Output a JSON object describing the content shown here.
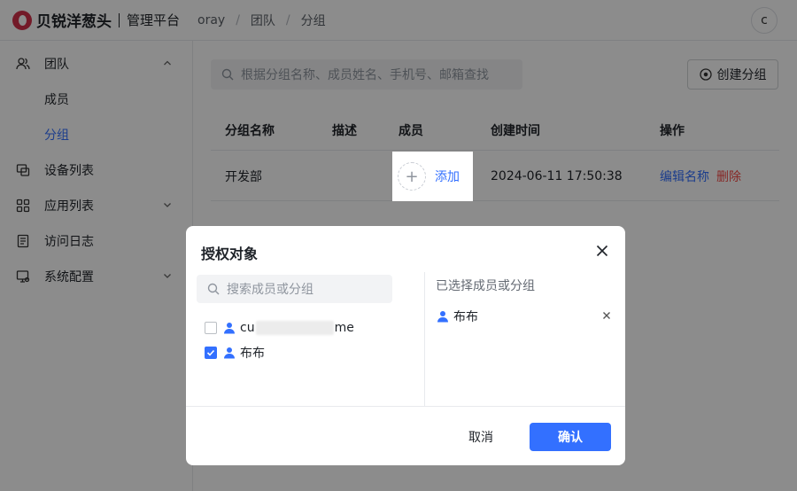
{
  "header": {
    "logo_text": "贝锐洋葱头",
    "platform": "管理平台",
    "breadcrumb": [
      "oray",
      "团队",
      "分组"
    ],
    "breadcrumb_sep": "/",
    "avatar_initial": "c"
  },
  "sidebar": {
    "team": "团队",
    "sub_members": "成员",
    "sub_groups": "分组",
    "devices": "设备列表",
    "apps": "应用列表",
    "logs": "访问日志",
    "settings": "系统配置"
  },
  "main": {
    "search_placeholder": "根据分组名称、成员姓名、手机号、邮箱查找",
    "create_button": "创建分组",
    "columns": [
      "分组名称",
      "描述",
      "成员",
      "创建时间",
      "操作"
    ],
    "rows": [
      {
        "name": "开发部",
        "description": "",
        "add_label": "添加",
        "created": "2024-06-11 17:50:38",
        "edit": "编辑名称",
        "delete": "删除"
      }
    ]
  },
  "modal": {
    "title": "授权对象",
    "search_placeholder": "搜索成员或分组",
    "members": [
      {
        "prefix": "cu",
        "suffix": "me",
        "checked": false
      },
      {
        "name": "布布",
        "checked": true
      }
    ],
    "selected_title": "已选择成员或分组",
    "selected": [
      "布布"
    ],
    "cancel": "取消",
    "confirm": "确认"
  },
  "colors": {
    "accent": "#3370ff",
    "danger": "#f54a45",
    "brand": "#d2314a"
  }
}
